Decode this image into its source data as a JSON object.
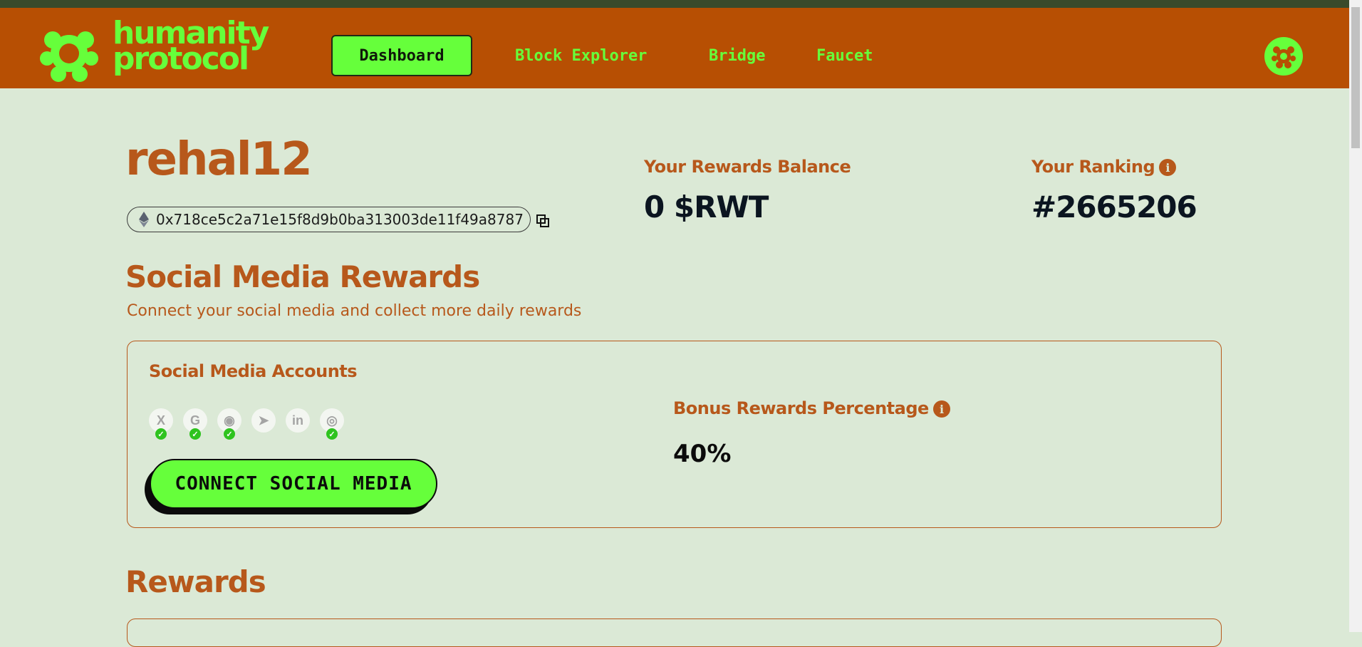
{
  "brand": {
    "line1": "humanity",
    "line2": "protocol",
    "color": "#66ff3b",
    "header_bg": "#b74f03"
  },
  "nav": {
    "dashboard": "Dashboard",
    "block_explorer": "Block Explorer",
    "bridge": "Bridge",
    "faucet": "Faucet"
  },
  "profile": {
    "username": "rehal12",
    "wallet_address": "0x718ce5c2a71e15f8d9b0ba313003de11f49a8787"
  },
  "stats": {
    "balance_label": "Your Rewards Balance",
    "balance_value": "0 $RWT",
    "ranking_label": "Your Ranking",
    "ranking_value": "#2665206"
  },
  "social_section": {
    "title": "Social Media Rewards",
    "subtitle": "Connect your social media and collect more daily rewards",
    "card_title": "Social Media Accounts",
    "accounts": [
      {
        "name": "x-icon",
        "glyph": "X",
        "connected": true
      },
      {
        "name": "google-icon",
        "glyph": "G",
        "connected": true
      },
      {
        "name": "discord-icon",
        "glyph": "◉",
        "connected": true
      },
      {
        "name": "telegram-icon",
        "glyph": "➤",
        "connected": false
      },
      {
        "name": "linkedin-icon",
        "glyph": "in",
        "connected": false
      },
      {
        "name": "github-icon",
        "glyph": "◎",
        "connected": true
      }
    ],
    "connect_button": "CONNECT SOCIAL MEDIA",
    "bonus_label": "Bonus Rewards Percentage",
    "bonus_value": "40%"
  },
  "rewards_section": {
    "title": "Rewards"
  }
}
